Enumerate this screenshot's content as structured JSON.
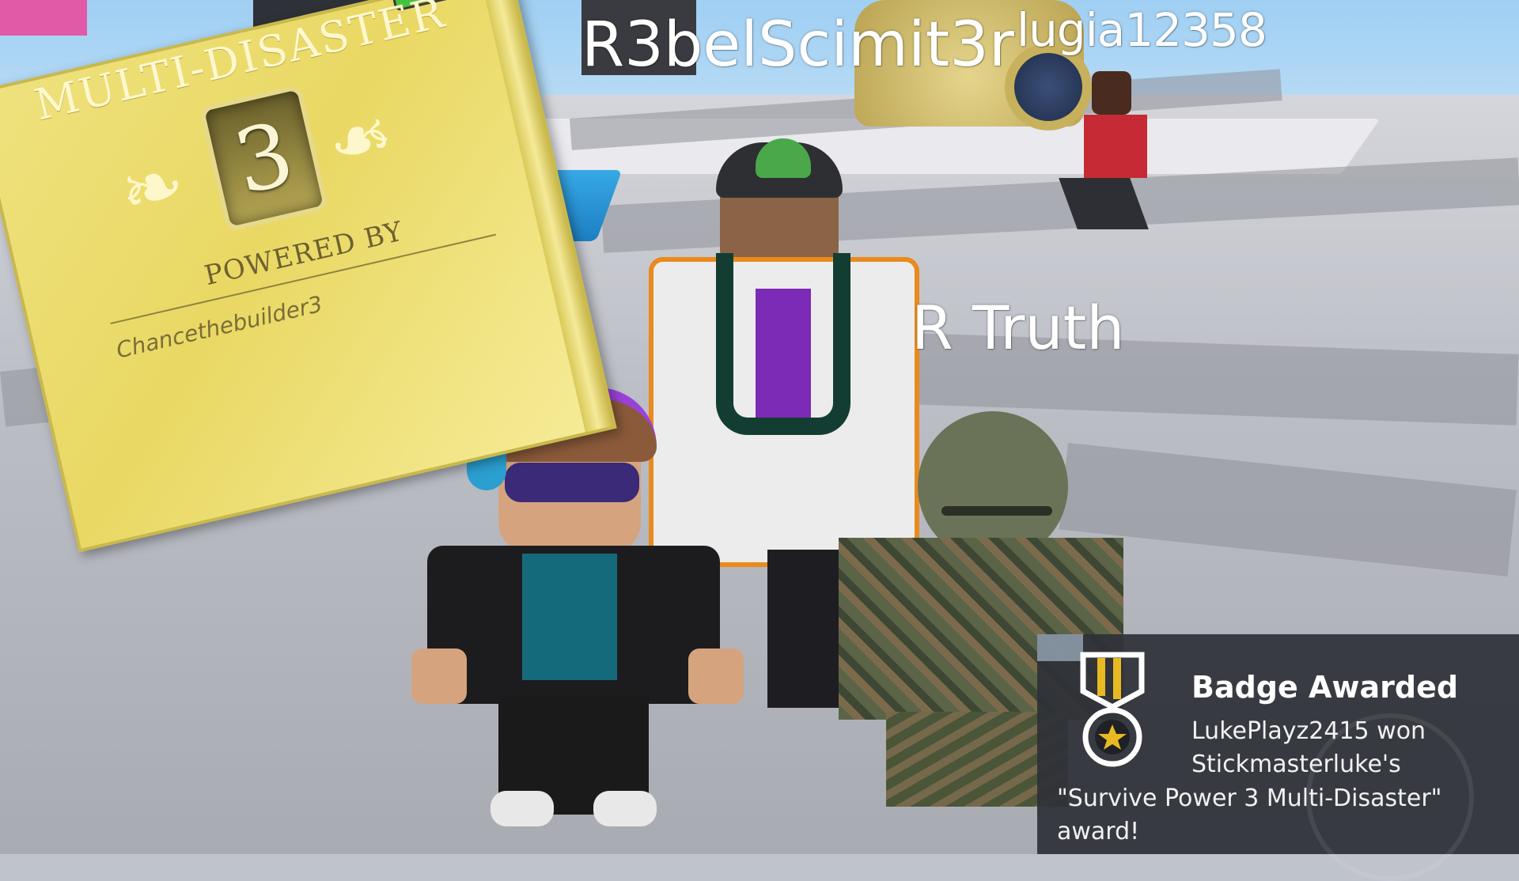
{
  "nametags": {
    "player1": "R3belScimit3r",
    "player2": "lugia12358",
    "player3": "R Truth"
  },
  "badge_card": {
    "title": "MULTI-DISASTER",
    "number": "3",
    "powered_by": "POWERED BY",
    "author": "Chancethebuilder3"
  },
  "notification": {
    "heading": "Badge Awarded",
    "line1": "LukePlayz2415 won",
    "line2": "Stickmasterluke's",
    "line3": "\"Survive Power 3 Multi-Disaster\"",
    "line4": "award!",
    "icon": "medal-icon"
  },
  "colors": {
    "badge_gold": "#e9d863",
    "notification_bg": "#2e3138",
    "floor": "#bcbec6"
  }
}
